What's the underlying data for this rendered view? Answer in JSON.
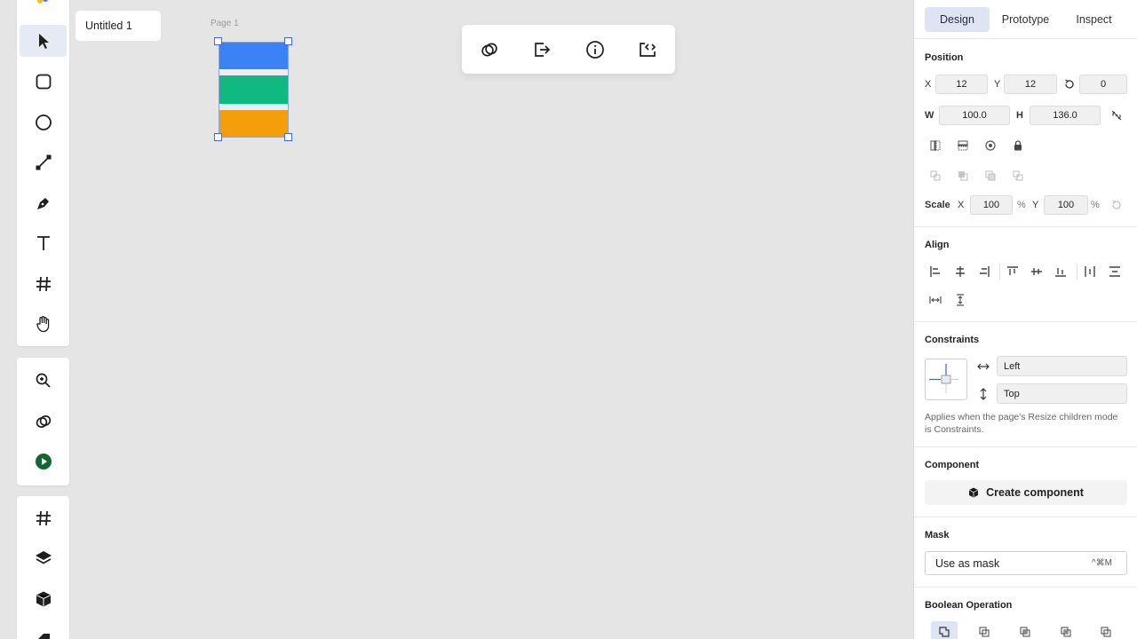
{
  "document": {
    "name": "Untitled 1",
    "page_label": "Page 1"
  },
  "left_toolbar": {
    "primary_tools": [
      {
        "name": "select",
        "icon": "cursor-arrow-icon",
        "active": true
      },
      {
        "name": "rectangle",
        "icon": "rounded-square-icon"
      },
      {
        "name": "ellipse",
        "icon": "circle-icon"
      },
      {
        "name": "line",
        "icon": "line-tool-icon"
      },
      {
        "name": "pen",
        "icon": "pen-nib-icon"
      },
      {
        "name": "text",
        "icon": "text-t-icon"
      },
      {
        "name": "frame",
        "icon": "hash-frame-icon"
      },
      {
        "name": "hand",
        "icon": "hand-icon"
      }
    ],
    "secondary_tools": [
      "zoom-in-icon",
      "overlap-rings-icon",
      "play-circle-icon"
    ],
    "tertiary_tools": [
      "hash-frame-icon",
      "layers-icon",
      "cube-icon"
    ]
  },
  "canvas": {
    "stripe_colors": [
      "#3b82f6",
      "#10b981",
      "#f59e0b"
    ]
  },
  "float_toolbar": [
    "overlap-rings-icon",
    "export-arrow-icon",
    "info-icon",
    "code-embed-icon"
  ],
  "panel": {
    "tabs": [
      "Design",
      "Prototype",
      "Inspect"
    ],
    "active_tab": "Design",
    "position": {
      "title": "Position",
      "x_label": "X",
      "x": "12",
      "y_label": "Y",
      "y": "12",
      "rotation": "0",
      "w_label": "W",
      "w": "100.0",
      "h_label": "H",
      "h": "136.0",
      "scale_label": "Scale",
      "scale_x_label": "X",
      "scale_x": "100",
      "scale_x_unit": "%",
      "scale_y_label": "Y",
      "scale_y": "100",
      "scale_y_unit": "%"
    },
    "align": {
      "title": "Align"
    },
    "constraints": {
      "title": "Constraints",
      "horizontal": "Left",
      "vertical": "Top",
      "note": "Applies when the page's Resize children mode is Constraints."
    },
    "component": {
      "title": "Component",
      "button": "Create component"
    },
    "mask": {
      "title": "Mask",
      "label": "Use as mask",
      "shortcut": "^⌘M"
    },
    "boolean": {
      "title": "Boolean Operation"
    }
  }
}
